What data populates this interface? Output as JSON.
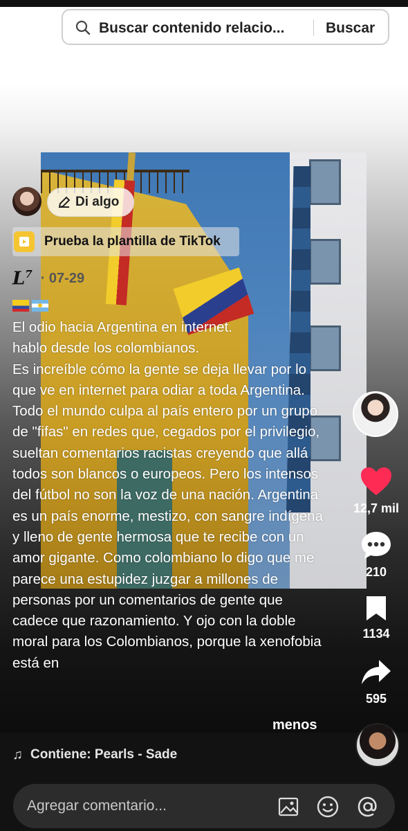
{
  "search": {
    "placeholder": "Buscar contenido relacio...",
    "button_label": "Buscar"
  },
  "author": {
    "say_something_label": "Di algo"
  },
  "template": {
    "label": "Prueba la plantilla de TikTok"
  },
  "post": {
    "brand_logo": "L",
    "brand_logo_sup": "7",
    "date": "· 07-29",
    "caption": "El odio hacia Argentina en internet.\nhablo desde los colombianos.\nEs increíble cómo la gente se deja llevar por lo que ve en internet para odiar a toda Argentina. Todo el mundo culpa al país entero por un grupo de \"fifas\" en redes que, cegados por el privilegio, sueltan comentarios racistas creyendo que allá todos son blancos o europeos. Pero los intensos del fútbol no son la voz de una nación. Argentina es un país enorme, mestizo, con sangre indígena y lleno de gente hermosa que te recibe con un amor gigante. Como colombiano lo digo que me parece una estupidez juzgar a millones de personas por un comentarios de gente que cadece que razonamiento. Y ojo con la doble moral para los Colombianos, porque la xenofobia está en",
    "less_label": "menos"
  },
  "actions": {
    "likes": "12,7 mil",
    "comments": "210",
    "saves": "1134",
    "shares": "595"
  },
  "music": {
    "label": "Contiene: Pearls - Sade"
  },
  "comment": {
    "placeholder": "Agregar comentario..."
  },
  "colors": {
    "like": "#fe2c55",
    "template_icon": "#f5c531"
  }
}
